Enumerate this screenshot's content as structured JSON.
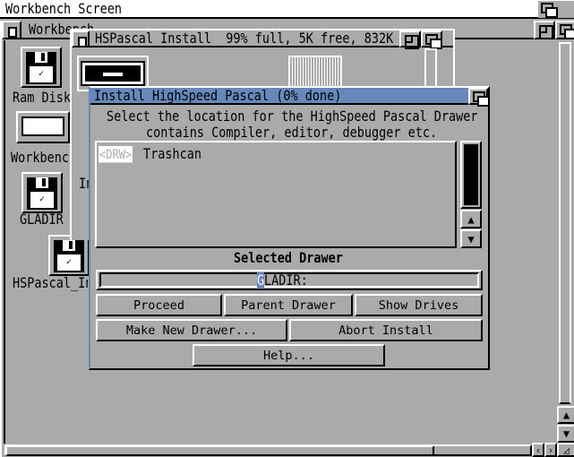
{
  "screen": {
    "title": "Workbench Screen"
  },
  "workbench_window": {
    "title": "Workbench"
  },
  "icons": [
    {
      "label": "Ram Disk"
    },
    {
      "label": "Workbench"
    },
    {
      "label": "GLADIR"
    },
    {
      "label": "HSPascal_Install"
    }
  ],
  "hspascal_window": {
    "title": "HSPascal_Install  99% full, 5K free, 832K",
    "icon_label_partial": "In"
  },
  "dialog": {
    "title": "Install_HighSpeed_Pascal (0% done)",
    "message_line1": "Select the location for the HighSpeed Pascal Drawer",
    "message_line2": "contains Compiler, editor, debugger etc.",
    "list_items": [
      {
        "tag": "<DRW>",
        "name": "Trashcan"
      }
    ],
    "selected_label": "Selected Drawer",
    "selected_value_cursor": "G",
    "selected_value_rest": "LADIR:",
    "buttons": {
      "proceed": "Proceed",
      "parent": "Parent Drawer",
      "show_drives": "Show Drives",
      "make_new": "Make New Drawer...",
      "abort": "Abort Install",
      "help": "Help..."
    }
  },
  "colors": {
    "gray": "#aaaaaa",
    "title_active": "#6688bb",
    "white": "#ffffff",
    "black": "#000000"
  }
}
